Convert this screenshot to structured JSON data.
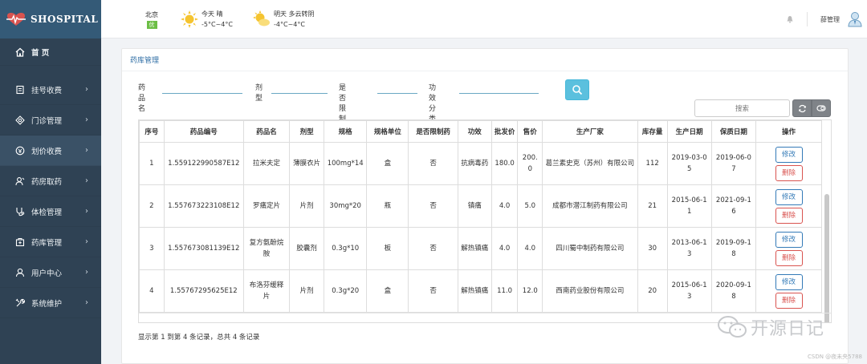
{
  "brand": {
    "name": "SHOSPITAL"
  },
  "sidebar": {
    "items": [
      {
        "label": "首 页",
        "icon": "home-icon",
        "arrow": ""
      },
      {
        "label": "挂号收费",
        "icon": "register-icon",
        "arrow": "›"
      },
      {
        "label": "门诊管理",
        "icon": "clinic-icon",
        "arrow": "›"
      },
      {
        "label": "划价收费",
        "icon": "billing-icon",
        "arrow": "›"
      },
      {
        "label": "药房取药",
        "icon": "pharmacy-icon",
        "arrow": "›"
      },
      {
        "label": "体检管理",
        "icon": "checkup-icon",
        "arrow": "›"
      },
      {
        "label": "药库管理",
        "icon": "warehouse-icon",
        "arrow": "›"
      },
      {
        "label": "用户中心",
        "icon": "user-icon",
        "arrow": "›"
      },
      {
        "label": "系统维护",
        "icon": "wrench-icon",
        "arrow": "›"
      }
    ]
  },
  "topbar": {
    "city": "北京",
    "aqi": "优",
    "today": {
      "line1": "今天  晴",
      "line2": "-5°C~4°C"
    },
    "tomorrow": {
      "line1": "明天  多云转阴",
      "line2": "-4°C~4°C"
    },
    "username": "薛管理"
  },
  "panel": {
    "title": "药库管理"
  },
  "filters": {
    "name_label": "药品名",
    "form_label": "剂型",
    "restricted_label": "是否限制药",
    "category_label": "功效分类"
  },
  "table_search": {
    "placeholder": "搜索"
  },
  "table": {
    "headers": [
      "序号",
      "药品编号",
      "药品名",
      "剂型",
      "规格",
      "规格单位",
      "是否限制药",
      "功效",
      "批发价",
      "售价",
      "生产厂家",
      "库存量",
      "生产日期",
      "保质日期",
      "操作"
    ],
    "rows": [
      [
        "1",
        "1.559122990587E12",
        "拉米夫定",
        "薄膜衣片",
        "100mg*14",
        "盒",
        "否",
        "抗病毒药",
        "180.0",
        "200.0",
        "葛兰素史克（苏州）有限公司",
        "112",
        "2019-03-05",
        "2019-06-07"
      ],
      [
        "2",
        "1.557673223108E12",
        "罗痛定片",
        "片剂",
        "30mg*20",
        "瓶",
        "否",
        "镇痛",
        "4.0",
        "5.0",
        "成都市潜江制药有限公司",
        "21",
        "2015-06-11",
        "2021-09-16"
      ],
      [
        "3",
        "1.557673081139E12",
        "复方氨酚烷胺",
        "胶囊剂",
        "0.3g*10",
        "板",
        "否",
        "解热镇痛",
        "4.0",
        "4.0",
        "四川蜀中制药有限公司",
        "30",
        "2013-06-13",
        "2019-09-18"
      ],
      [
        "4",
        "1.55767295625E12",
        "布洛芬缓释片",
        "片剂",
        "0.3g*20",
        "盒",
        "否",
        "解热镇痛",
        "11.0",
        "12.0",
        "西南药业股份有限公司",
        "20",
        "2015-06-13",
        "2020-09-18"
      ]
    ],
    "edit_label": "修改",
    "delete_label": "删除"
  },
  "footer": {
    "summary": "显示第 1 到第 4 条记录，总共 4 条记录"
  },
  "watermark": {
    "text": "开源日记",
    "csdn": "CSDN @夜未央5788"
  },
  "colors": {
    "sidebar": "#2f4254",
    "brand": "#345a77",
    "search_button": "#5bc0de",
    "edit": "#337ab7",
    "delete": "#d9534f"
  }
}
